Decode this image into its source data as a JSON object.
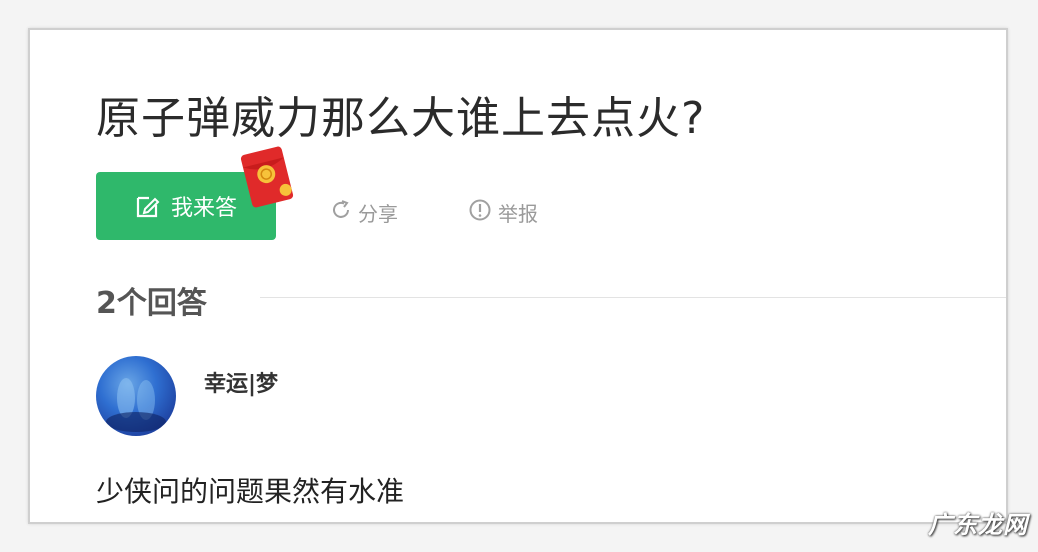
{
  "question": {
    "title": "原子弹威力那么大谁上去点火?"
  },
  "actions": {
    "answer_label": "我来答",
    "share_label": "分享",
    "report_label": "举报"
  },
  "answers": {
    "count_label": "2个回答",
    "items": [
      {
        "username": "幸运|梦",
        "text": "少侠问的问题果然有水准"
      }
    ]
  },
  "watermark": {
    "text": "广东龙网"
  },
  "colors": {
    "accent": "#2fb86b",
    "redpacket": "#e02a2a",
    "muted_text": "#9a9a9a"
  },
  "icons": {
    "answer": "edit-icon",
    "share": "share-icon",
    "report": "report-icon",
    "redpacket": "redpacket-icon"
  }
}
